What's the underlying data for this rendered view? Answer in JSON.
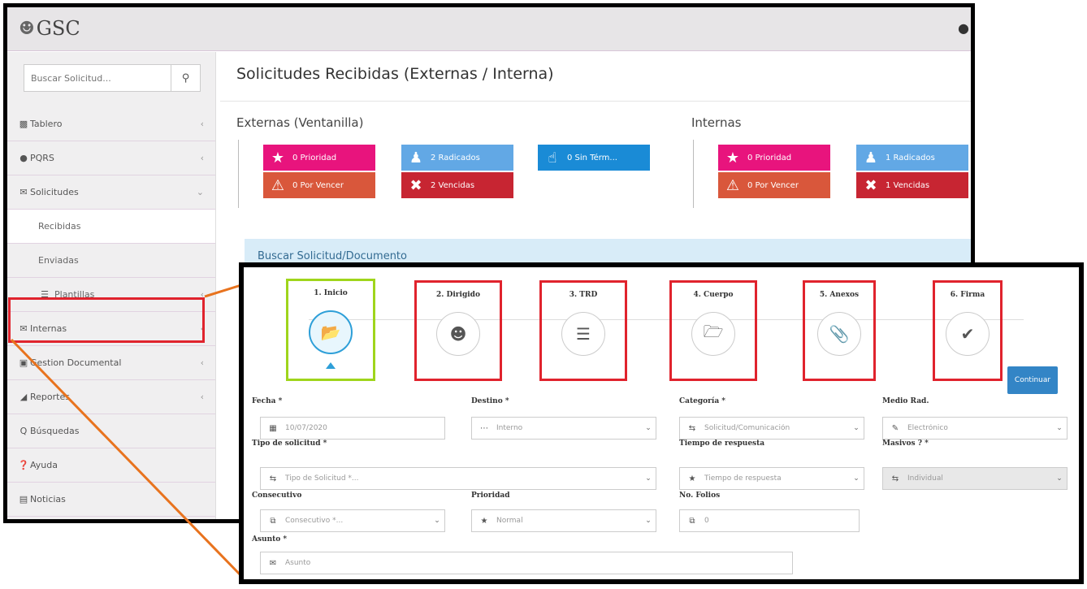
{
  "app": {
    "name": "GSC"
  },
  "colors": {
    "pink": "#e8147d",
    "orange": "#d9573b",
    "light_blue": "#62a8e5",
    "red": "#c72532",
    "blue": "#1a8bd6",
    "accent_line": "#e8731e",
    "highlight_red": "#e0232d",
    "highlight_green": "#9fd51c"
  },
  "sidebar": {
    "search": {
      "placeholder": "Buscar Solicitud...",
      "icon": "search-icon"
    },
    "items": [
      {
        "label": "Tablero",
        "icon": "bar-chart-icon"
      },
      {
        "label": "PQRS",
        "icon": "comments-icon"
      },
      {
        "label": "Solicitudes",
        "icon": "envelope-icon"
      },
      {
        "label": "Recibidas"
      },
      {
        "label": "Enviadas"
      },
      {
        "label": "Plantillas",
        "icon": "list-icon"
      },
      {
        "label": "Internas",
        "icon": "envelope-icon"
      },
      {
        "label": "Gestion Documental",
        "icon": "folder-icon"
      },
      {
        "label": "Reportes",
        "icon": "area-chart-icon"
      },
      {
        "label": "Búsquedas",
        "icon": "search-icon"
      },
      {
        "label": "Ayuda",
        "icon": "question-icon"
      },
      {
        "label": "Noticias",
        "icon": "newspaper-icon"
      }
    ]
  },
  "main": {
    "title": "Solicitudes Recibidas (Externas / Interna)",
    "externas": {
      "label": "Externas (Ventanilla)",
      "tiles": [
        {
          "text": "0 Prioridad",
          "icon": "star-icon",
          "color": "#e8147d"
        },
        {
          "text": "2 Radicados",
          "icon": "user-icon",
          "color": "#62a8e5"
        },
        {
          "text": "0 Sin Térm...",
          "icon": "thumbs-up-icon",
          "color": "#1a8bd6"
        },
        {
          "text": "0 Por Vencer",
          "icon": "warning-icon",
          "color": "#d9573b"
        },
        {
          "text": "2 Vencidas",
          "icon": "times-icon",
          "color": "#c72532"
        }
      ]
    },
    "internas": {
      "label": "Internas",
      "tiles": [
        {
          "text": "0 Prioridad",
          "icon": "star-icon",
          "color": "#e8147d"
        },
        {
          "text": "1 Radicados",
          "icon": "user-icon",
          "color": "#62a8e5"
        },
        {
          "text": "0 Por Vencer",
          "icon": "warning-icon",
          "color": "#d9573b"
        },
        {
          "text": "1 Vencidas",
          "icon": "times-icon",
          "color": "#c72532"
        }
      ]
    },
    "search_panel": "Buscar Solicitud/Documento"
  },
  "wizard": {
    "steps": [
      {
        "label": "1. Inicio",
        "icon": "folder-open-icon"
      },
      {
        "label": "2. Dirigido",
        "icon": "users-icon"
      },
      {
        "label": "3. TRD",
        "icon": "list-icon"
      },
      {
        "label": "4. Cuerpo",
        "icon": "folder-edit-icon"
      },
      {
        "label": "5. Anexos",
        "icon": "paperclip-icon"
      },
      {
        "label": "6. Firma",
        "icon": "check-icon"
      }
    ],
    "continue_label": "Continuar",
    "form": {
      "fecha": {
        "label": "Fecha *",
        "value": "10/07/2020"
      },
      "destino": {
        "label": "Destino *",
        "value": "Interno"
      },
      "categoria": {
        "label": "Categoría *",
        "value": "Solicitud/Comunicación"
      },
      "medio": {
        "label": "Medio Rad.",
        "value": "Electrónico"
      },
      "tipo": {
        "label": "Tipo de solicitud *",
        "value": "Tipo de Solicitud *..."
      },
      "tiempo": {
        "label": "Tiempo de respuesta",
        "value": "Tiempo de respuesta"
      },
      "masivos": {
        "label": "Masivos ? *",
        "value": "Individual"
      },
      "consecutivo": {
        "label": "Consecutivo",
        "value": "Consecutivo *..."
      },
      "prioridad": {
        "label": "Prioridad",
        "value": "Normal"
      },
      "folios": {
        "label": "No. Folios",
        "value": "0"
      },
      "asunto": {
        "label": "Asunto *",
        "placeholder": "Asunto"
      }
    }
  }
}
